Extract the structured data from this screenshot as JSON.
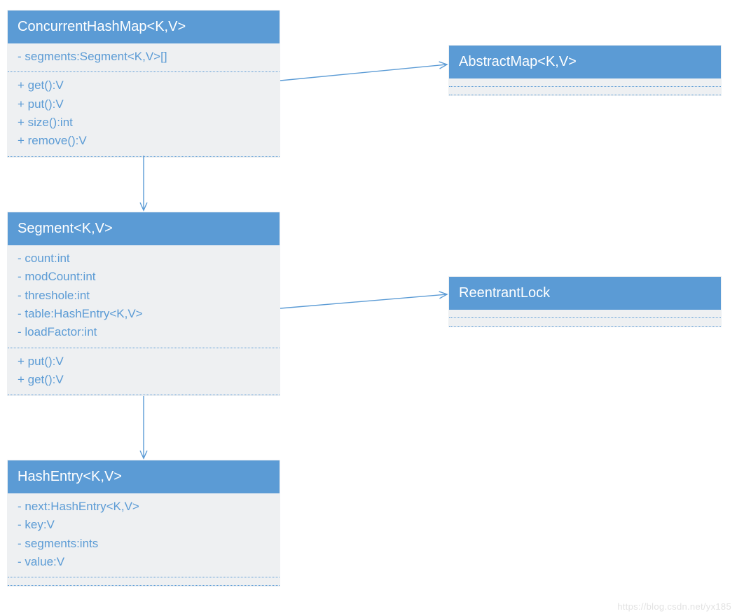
{
  "colors": {
    "header_bg": "#5b9bd5",
    "body_bg": "#eef0f2",
    "text": "#5b9bd5",
    "line": "#5b9bd5"
  },
  "watermark": "https://blog.csdn.net/yx185",
  "classes": {
    "concurrentHashMap": {
      "title": "ConcurrentHashMap<K,V>",
      "fields": [
        "- segments:Segment<K,V>[]"
      ],
      "methods": [
        "+ get():V",
        "+ put():V",
        "+ size():int",
        "+ remove():V"
      ]
    },
    "abstractMap": {
      "title": "AbstractMap<K,V>",
      "fields": [],
      "methods": []
    },
    "segment": {
      "title": "Segment<K,V>",
      "fields": [
        "- count:int",
        "- modCount:int",
        "- threshole:int",
        "- table:HashEntry<K,V>",
        "- loadFactor:int"
      ],
      "methods": [
        "+ put():V",
        "+ get():V"
      ]
    },
    "reentrantLock": {
      "title": "ReentrantLock",
      "fields": [],
      "methods": []
    },
    "hashEntry": {
      "title": "HashEntry<K,V>",
      "fields": [
        "- next:HashEntry<K,V>",
        "- key:V",
        "- segments:ints",
        "- value:V"
      ],
      "methods": []
    }
  },
  "relations": [
    {
      "from": "concurrentHashMap",
      "to": "abstractMap",
      "kind": "open-arrow"
    },
    {
      "from": "concurrentHashMap",
      "to": "segment",
      "kind": "open-arrow"
    },
    {
      "from": "segment",
      "to": "reentrantLock",
      "kind": "open-arrow"
    },
    {
      "from": "segment",
      "to": "hashEntry",
      "kind": "open-arrow"
    }
  ]
}
